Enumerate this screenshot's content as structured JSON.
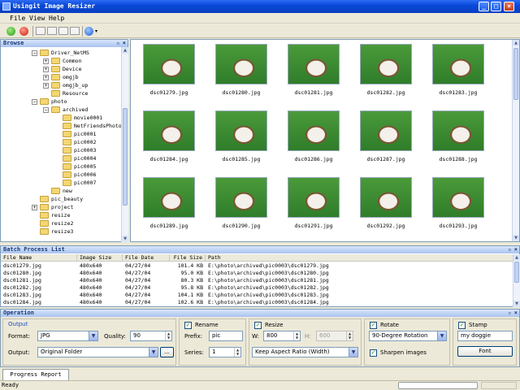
{
  "window": {
    "title": "Usingit Image Resizer"
  },
  "menu": {
    "items": [
      {
        "label": "File"
      },
      {
        "label": "View"
      },
      {
        "label": "Help"
      }
    ]
  },
  "browse": {
    "title": "Browse",
    "tree": [
      {
        "label": "Driver_NetMS",
        "expanded": true
      },
      {
        "label": "Common",
        "expanded": false
      },
      {
        "label": "Device",
        "expanded": false
      },
      {
        "label": "omgjb",
        "expanded": false
      },
      {
        "label": "omgjb_up",
        "expanded": false
      },
      {
        "label": "Resource",
        "expanded": null
      },
      {
        "label": "photo",
        "expanded": true
      },
      {
        "label": "archived",
        "expanded": true
      },
      {
        "label": "movie0001",
        "expanded": null
      },
      {
        "label": "NetFriendsPhoto",
        "expanded": null
      },
      {
        "label": "pic0001",
        "expanded": null
      },
      {
        "label": "pic0002",
        "expanded": null
      },
      {
        "label": "pic0003",
        "expanded": null
      },
      {
        "label": "pic0004",
        "expanded": null
      },
      {
        "label": "pic0005",
        "expanded": null
      },
      {
        "label": "pic0006",
        "expanded": null
      },
      {
        "label": "pic0007",
        "expanded": null
      },
      {
        "label": "new",
        "expanded": null
      },
      {
        "label": "pic_beauty",
        "expanded": null
      },
      {
        "label": "project",
        "expanded": false
      },
      {
        "label": "resize",
        "expanded": null
      },
      {
        "label": "resize2",
        "expanded": null
      },
      {
        "label": "resize3",
        "expanded": null
      }
    ]
  },
  "thumbnails": [
    {
      "name": "dsc01279.jpg"
    },
    {
      "name": "dsc01280.jpg"
    },
    {
      "name": "dsc01281.jpg"
    },
    {
      "name": "dsc01282.jpg"
    },
    {
      "name": "dsc01283.jpg"
    },
    {
      "name": "dsc01284.jpg"
    },
    {
      "name": "dsc01285.jpg"
    },
    {
      "name": "dsc01286.jpg"
    },
    {
      "name": "dsc01287.jpg"
    },
    {
      "name": "dsc01288.jpg"
    },
    {
      "name": "dsc01289.jpg"
    },
    {
      "name": "dsc01290.jpg"
    },
    {
      "name": "dsc01291.jpg"
    },
    {
      "name": "dsc01292.jpg"
    },
    {
      "name": "dsc01293.jpg"
    }
  ],
  "batch": {
    "title": "Batch Process List",
    "columns": [
      "File Name",
      "Image Size",
      "File Date",
      "File Size",
      "Path"
    ],
    "rows": [
      [
        "dsc01279.jpg",
        "480x640",
        "04/27/04",
        "101.4 KB",
        "E:\\photo\\archived\\pic0003\\dsc01279.jpg"
      ],
      [
        "dsc01280.jpg",
        "480x640",
        "04/27/04",
        "95.0 KB",
        "E:\\photo\\archived\\pic0003\\dsc01280.jpg"
      ],
      [
        "dsc01281.jpg",
        "480x640",
        "04/27/04",
        "80.3 KB",
        "E:\\photo\\archived\\pic0003\\dsc01281.jpg"
      ],
      [
        "dsc01282.jpg",
        "480x640",
        "04/27/04",
        "95.8 KB",
        "E:\\photo\\archived\\pic0003\\dsc01282.jpg"
      ],
      [
        "dsc01283.jpg",
        "480x640",
        "04/27/04",
        "104.1 KB",
        "E:\\photo\\archived\\pic0003\\dsc01283.jpg"
      ],
      [
        "dsc01284.jpg",
        "480x640",
        "04/27/04",
        "102.6 KB",
        "E:\\photo\\archived\\pic0003\\dsc01284.jpg"
      ]
    ]
  },
  "operation": {
    "title": "Operation",
    "output": {
      "legend": "Output",
      "format_label": "Format:",
      "format_value": "JPG",
      "quality_label": "Quality:",
      "quality_value": "90",
      "output_label": "Output:",
      "output_value": "Original Folder",
      "browse_label": "..."
    },
    "rename": {
      "label": "Rename",
      "checked": true,
      "prefix_label": "Prefix:",
      "prefix_value": "pic",
      "series_label": "Series:",
      "series_value": "1"
    },
    "resize": {
      "label": "Resize",
      "checked": true,
      "w_label": "W:",
      "w_value": "800",
      "h_label": "H:",
      "h_value": "600",
      "mode_value": "Keep Aspect Ratio (Width)"
    },
    "rotate": {
      "label": "Rotate",
      "checked": true,
      "value": "90-Degree Rotation",
      "sharpen_label": "Sharpen images",
      "sharpen_checked": true
    },
    "stamp": {
      "label": "Stamp",
      "checked": true,
      "text_value": "my doggie",
      "font_label": "Font"
    }
  },
  "tabs": [
    {
      "label": "Progress Report"
    }
  ],
  "status": {
    "text": "Ready"
  }
}
